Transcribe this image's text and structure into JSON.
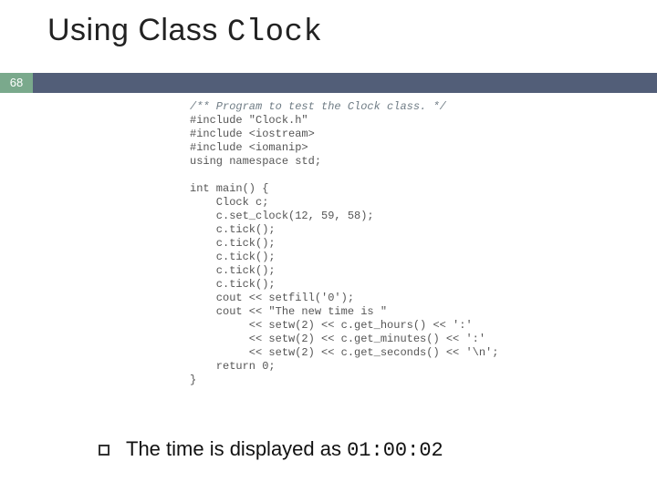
{
  "title": {
    "prefix": "Using Class ",
    "mono": "Clock"
  },
  "slide_number": "68",
  "code": {
    "comment": "/** Program to test the Clock class. */",
    "lines": [
      "#include \"Clock.h\"",
      "#include <iostream>",
      "#include <iomanip>",
      "using namespace std;",
      "",
      "int main() {",
      "    Clock c;",
      "    c.set_clock(12, 59, 58);",
      "    c.tick();",
      "    c.tick();",
      "    c.tick();",
      "    c.tick();",
      "    c.tick();",
      "    cout << setfill('0');",
      "    cout << \"The new time is \"",
      "         << setw(2) << c.get_hours() << ':'",
      "         << setw(2) << c.get_minutes() << ':'",
      "         << setw(2) << c.get_seconds() << '\\n';",
      "    return 0;",
      "}"
    ]
  },
  "bullet": {
    "prefix": "The time is displayed as ",
    "mono": "01:00:02"
  }
}
